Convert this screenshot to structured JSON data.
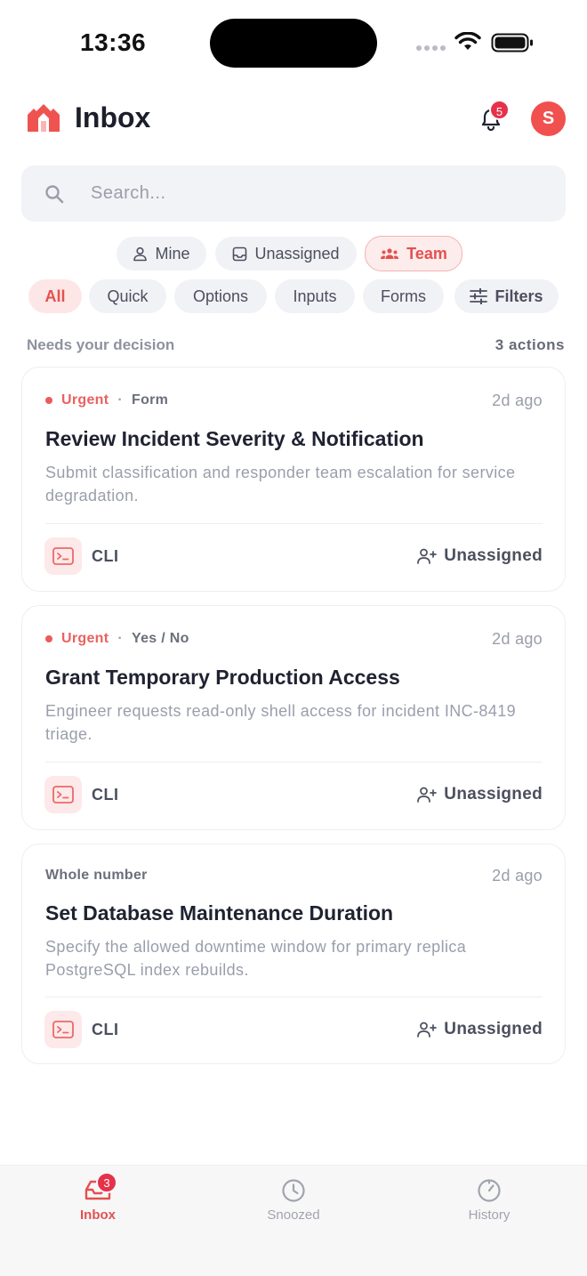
{
  "status_bar": {
    "time": "13:36"
  },
  "header": {
    "title": "Inbox",
    "notification_count": "5",
    "avatar_initial": "S"
  },
  "search": {
    "placeholder": "Search..."
  },
  "scope_chips": [
    {
      "label": "Mine"
    },
    {
      "label": "Unassigned"
    },
    {
      "label": "Team"
    }
  ],
  "type_chips": [
    {
      "label": "All"
    },
    {
      "label": "Quick"
    },
    {
      "label": "Options"
    },
    {
      "label": "Inputs"
    },
    {
      "label": "Forms"
    },
    {
      "label": "Filters"
    }
  ],
  "section": {
    "title": "Needs your decision",
    "count": "3 actions"
  },
  "cards": [
    {
      "urgency": "Urgent",
      "separator": "·",
      "type": "Form",
      "time": "2d ago",
      "title": "Review Incident Severity & Notification",
      "description": "Submit classification and responder team escalation for service degradation.",
      "source": "CLI",
      "assignee": "Unassigned"
    },
    {
      "urgency": "Urgent",
      "separator": "·",
      "type": "Yes / No",
      "time": "2d ago",
      "title": "Grant Temporary Production Access",
      "description": "Engineer requests read-only shell access for incident INC-8419 triage.",
      "source": "CLI",
      "assignee": "Unassigned"
    },
    {
      "type": "Whole number",
      "time": "2d ago",
      "title": "Set Database Maintenance Duration",
      "description": "Specify the allowed downtime window for primary replica PostgreSQL index rebuilds.",
      "source": "CLI",
      "assignee": "Unassigned"
    }
  ],
  "tabbar": {
    "inbox": {
      "label": "Inbox",
      "badge": "3"
    },
    "snoozed": {
      "label": "Snoozed"
    },
    "history": {
      "label": "History"
    }
  },
  "colors": {
    "accent": "#e4504f",
    "badge": "#e5324b",
    "muted": "#9a9eab"
  }
}
